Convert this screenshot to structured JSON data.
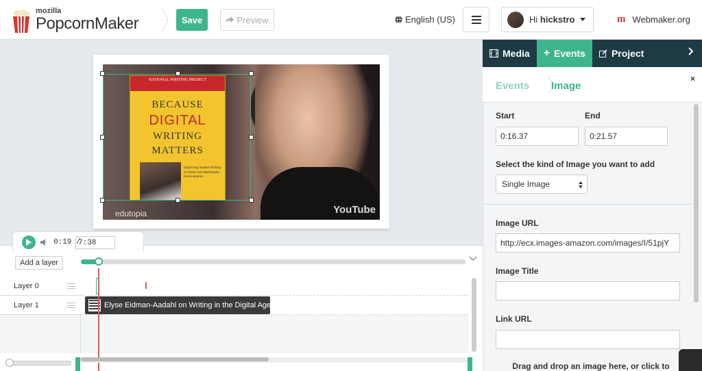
{
  "header": {
    "logo_small": "mozilla",
    "logo_big": "PopcornMaker",
    "save_label": "Save",
    "preview_label": "Preview",
    "language": "English (US)",
    "user_greeting_prefix": "Hi ",
    "username": "hickstro",
    "webmaker_label": "Webmaker.org"
  },
  "video": {
    "book_top": "NATIONAL WRITING PROJECT",
    "book_line1": "BECAUSE",
    "book_line2": "DIGITAL",
    "book_line3": "WRITING",
    "book_line4": "MATTERS",
    "book_sub": "Improving Student Writing in Online and Multimedia Environments",
    "watermark": "YouTube",
    "corner_brand": "edutopia"
  },
  "player": {
    "current_time": "0:19",
    "separator": "/",
    "duration": "7:38"
  },
  "timeline": {
    "add_layer_label": "Add a layer",
    "layers": [
      "Layer 0",
      "Layer 1"
    ],
    "clip_title": "Elyse Eidman-Aadahl on Writing in the Digital Age..."
  },
  "panel": {
    "tabs": [
      {
        "label": "Media",
        "icon": "film-icon"
      },
      {
        "label": "Events",
        "icon": "plus-icon"
      },
      {
        "label": "Project",
        "icon": "edit-icon"
      }
    ],
    "next_icon": "chevron-right-icon",
    "breadcrumb_root": "Events",
    "breadcrumb_current": "Image",
    "close_symbol": "×",
    "start_label": "Start",
    "start_value": "0:16.37",
    "end_label": "End",
    "end_value": "0:21.57",
    "kind_label": "Select the kind of Image you want to add",
    "kind_value": "Single Image",
    "image_url_label": "Image URL",
    "image_url_value": "http://ecx.images-amazon.com/images/I/51pjY",
    "image_title_label": "Image Title",
    "image_title_value": "",
    "link_url_label": "Link URL",
    "link_url_value": "",
    "dropzone_text": "Drag and drop an image here, or click to"
  },
  "colors": {
    "accent": "#3fb58e",
    "nav_dark": "#1d3a45",
    "playhead": "#e05a5a"
  }
}
